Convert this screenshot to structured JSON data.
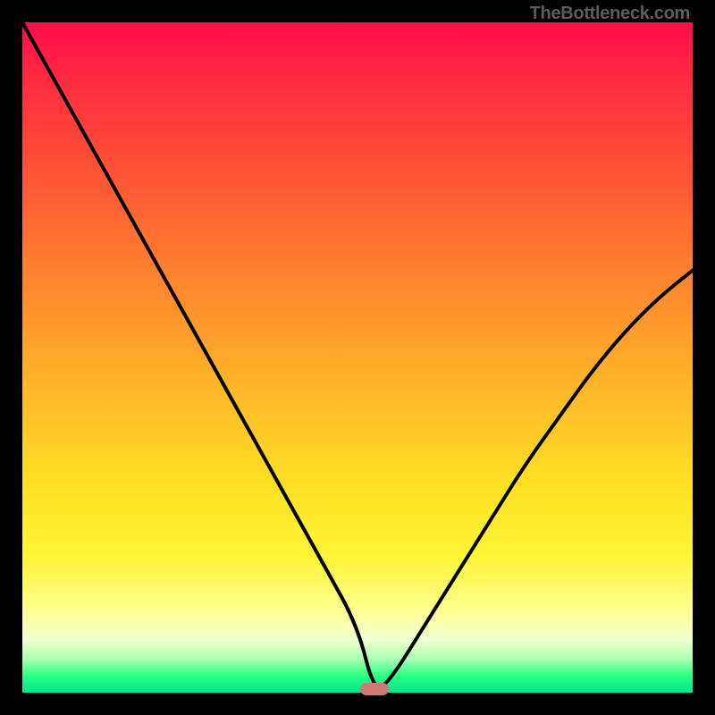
{
  "attribution": "TheBottleneck.com",
  "chart_data": {
    "type": "line",
    "title": "",
    "xlabel": "",
    "ylabel": "",
    "xlim": [
      0,
      100
    ],
    "ylim": [
      0,
      100
    ],
    "series": [
      {
        "name": "bottleneck-curve",
        "x": [
          0,
          5,
          10,
          15,
          20,
          25,
          30,
          35,
          40,
          45,
          50,
          52.5,
          55,
          60,
          65,
          70,
          75,
          80,
          85,
          90,
          95,
          100
        ],
        "values": [
          100,
          91,
          82,
          73,
          64,
          55,
          46,
          37,
          28,
          19,
          10,
          0,
          2,
          10,
          18,
          26,
          34,
          41,
          48,
          54,
          59,
          63
        ]
      }
    ],
    "minimum_point": {
      "x": 52.5,
      "y": 0
    },
    "gradient_colors": {
      "top": "#ff0d4b",
      "mid_orange": "#ff8a2e",
      "mid_yellow": "#ffe324",
      "bottom": "#00e58a"
    },
    "curve_stroke": "#000000",
    "marker_color": "#cb7b74"
  }
}
